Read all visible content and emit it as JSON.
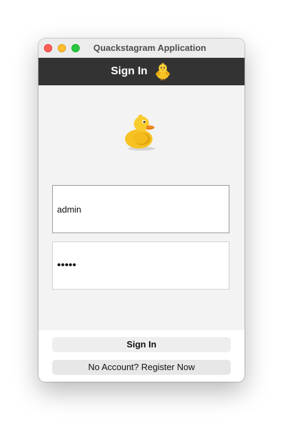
{
  "window": {
    "title": "Quackstagram Application"
  },
  "header": {
    "title": "Sign In",
    "icon": "chick-icon"
  },
  "logo": {
    "icon": "duck-logo-icon"
  },
  "form": {
    "username_value": "admin",
    "password_value": "•••••"
  },
  "buttons": {
    "sign_in_label": "Sign In",
    "register_label": "No Account? Register Now"
  },
  "colors": {
    "header_bg": "#333333",
    "duck_yellow": "#f6c224",
    "beak_orange": "#f08a1c"
  }
}
